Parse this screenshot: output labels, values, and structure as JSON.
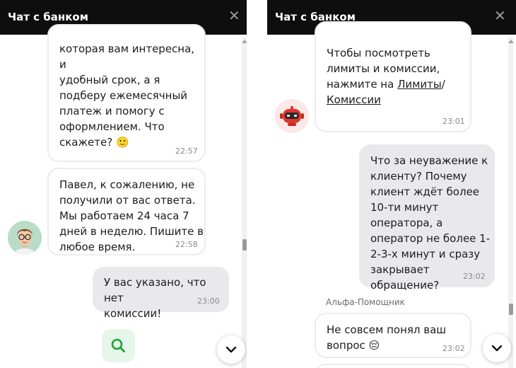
{
  "left_panel": {
    "header_title": "Чат с банком",
    "messages": [
      {
        "lines": [
          "которая вам интересна, и",
          "удобный срок, а я",
          "подберу ежемесячный",
          "платеж и помогу с",
          "оформлением. Что"
        ],
        "last_line": "скажете?",
        "emoji": "🙂",
        "time": "22:57"
      },
      {
        "lines": [
          "Павел, к сожалению, не",
          "получили от вас ответа.",
          "Мы работаем 24 часа 7",
          "дней в неделю. Пишите в"
        ],
        "last_line": "любое время.",
        "time": "22:58"
      },
      {
        "lines": [
          "У вас указано, что нет"
        ],
        "last_line": "комиссии!",
        "time": "23:00"
      }
    ]
  },
  "right_panel": {
    "header_title": "Чат с банком",
    "bot_message": {
      "lines": [
        "Чтобы посмотреть",
        "лимиты и комиссии,"
      ],
      "line3_prefix": "нажмите на ",
      "link1": "Лимиты",
      "slash": "/",
      "link2": "Комиссии",
      "time": "23:01"
    },
    "user_message": {
      "lines": [
        "Что за неуважение к",
        "клиенту? Почему",
        "клиент ждёт более",
        "10-ти минут",
        "оператора, а",
        "оператор не более 1-",
        "2-3-х минут и сразу",
        "закрывает"
      ],
      "last_line": "обращение?",
      "time": "23:02"
    },
    "sender_label": "Альфа-Помощник",
    "bot_reply": {
      "lines": [
        "Не совсем понял ваш"
      ],
      "last_line": "вопрос",
      "emoji": "😔",
      "time": "23:02"
    }
  },
  "icons": {
    "close": "close-icon",
    "scroll_down": "chevron-down-icon",
    "search": "search-icon"
  },
  "colors": {
    "header_bg": "#0e0e0e",
    "outgoing_bubble": "#e9e9eb",
    "incoming_border": "#ececec",
    "search_accent": "#21a038",
    "bot_red": "#e0352d"
  }
}
